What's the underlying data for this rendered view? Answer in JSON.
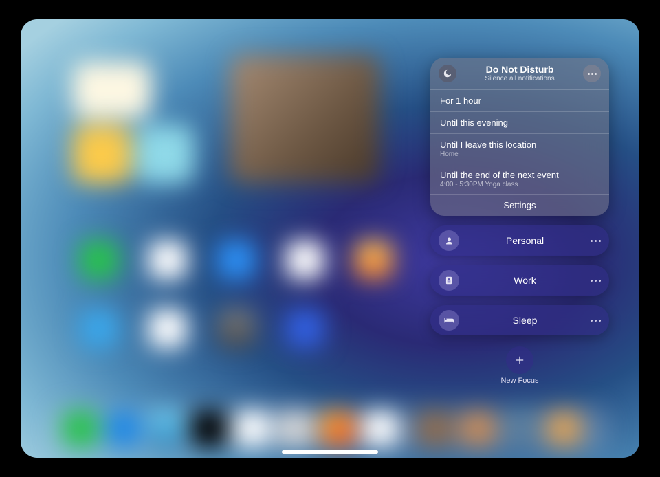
{
  "dnd": {
    "title": "Do Not Disturb",
    "subtitle": "Silence all notifications",
    "options": [
      {
        "label": "For 1 hour"
      },
      {
        "label": "Until this evening"
      },
      {
        "label": "Until I leave this location",
        "sub": "Home"
      },
      {
        "label": "Until the end of the next event",
        "sub": "4:00 - 5:30PM Yoga class"
      }
    ],
    "settings_label": "Settings"
  },
  "focus_modes": [
    {
      "name": "Personal",
      "icon": "person"
    },
    {
      "name": "Work",
      "icon": "badge"
    },
    {
      "name": "Sleep",
      "icon": "bed"
    }
  ],
  "new_focus_label": "New Focus"
}
